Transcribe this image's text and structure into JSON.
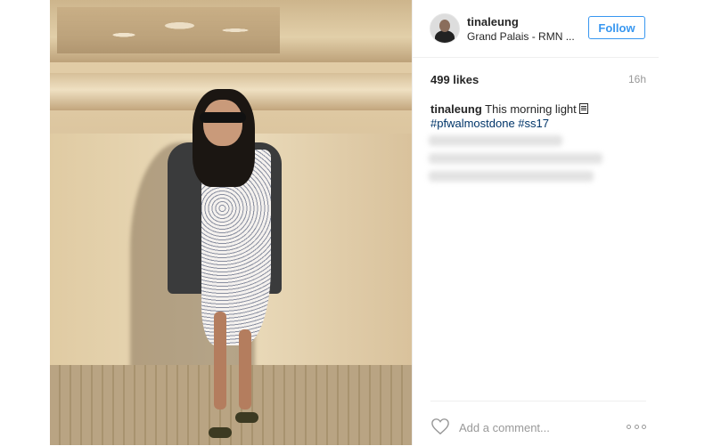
{
  "post": {
    "username": "tinaleung",
    "location": "Grand Palais - RMN ...",
    "follow_label": "Follow",
    "likes": "499 likes",
    "time_ago": "16h",
    "caption": {
      "username": "tinaleung",
      "text": "This morning light",
      "hashtags": [
        "#pfwalmostdone",
        "#ss17"
      ]
    },
    "comment_placeholder": "Add a comment...",
    "colors": {
      "accent": "#3897f0",
      "hashtag": "#003569",
      "muted": "#999999"
    }
  }
}
